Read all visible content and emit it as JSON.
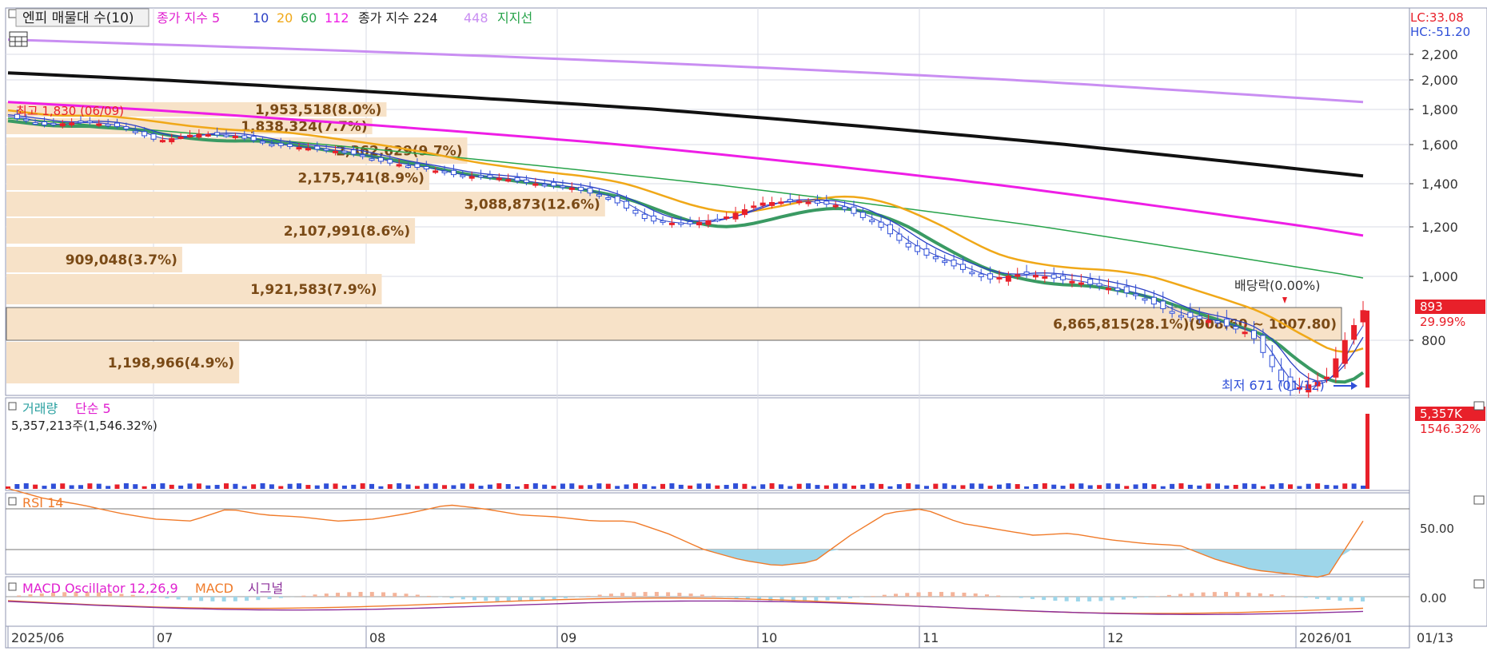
{
  "colors": {
    "up": "#e8202a",
    "down": "#2f4fd8",
    "ma5": "#2a3fc4",
    "ma10": "#2a3fc4",
    "ma20": "#f0a818",
    "ma60": "#27a34a",
    "ma112": "#ee1ee6",
    "ma224": "#111111",
    "ma448": "#c98ef2",
    "support": "#3a9a63",
    "volprofile": "#f7e2c8",
    "volprofile_text": "#7a4a16",
    "rsi": "#f07b2a",
    "rsi_fill": "#9ed6ea",
    "macd": "#f07b2a",
    "signal": "#8c2f9b",
    "osc": "#9ed6ea",
    "panel_bg": "#ffffff",
    "axis_bg": "#ffffff",
    "grid": "#d9dbe6"
  },
  "price_panel": {
    "legend": {
      "title_label": "엔피 매물대 수(10)",
      "ma_label": "종가 지수 5",
      "ma10": "10",
      "ma20": "20",
      "ma60": "60",
      "ma112": "112",
      "ma224_label": "종가 지수 224",
      "ma448": "448",
      "support_label": "지지선"
    },
    "lc_text": "LC:33.08",
    "hc_text": "HC:-51.20",
    "high_annotation": "최고 1,830 (06/09)",
    "low_annotation": "최저 671 (01/12)",
    "dividend_annotation": "배당락(0.00%)",
    "current_price_tag": "893",
    "current_change_tag": "29.99%",
    "y_ticks": [
      "2,200",
      "2,000",
      "1,800",
      "1,600",
      "1,400",
      "1,200",
      "1,000",
      "800"
    ]
  },
  "volume_profile": [
    {
      "label": "1,953,518(8.0%)",
      "price_level": 1690
    },
    {
      "label": "1,838,324(7.7%)",
      "price_level": 1605
    },
    {
      "label": "2,362,629(9.7%)",
      "price_level": 1510
    },
    {
      "label": "2,175,741(8.9%)",
      "price_level": 1410
    },
    {
      "label": "3,088,873(12.6%)",
      "price_level": 1300
    },
    {
      "label": "2,107,991(8.6%)",
      "price_level": 1195
    },
    {
      "label": "909,048(3.7%)",
      "price_level": 1095
    },
    {
      "label": "1,921,583(7.9%)",
      "price_level": 985
    },
    {
      "label": "6,865,815(28.1%)(908.60 ~ 1007.80)",
      "price_level": 880
    },
    {
      "label": "1,198,966(4.9%)",
      "price_level": 775
    }
  ],
  "volume_panel": {
    "legend_label": "거래량",
    "legend_ma": "단순 5",
    "last_text": "5,357,213주(1,546.32%)",
    "tag_value": "5,357K",
    "tag_change": "1546.32%"
  },
  "rsi_panel": {
    "legend_label": "RSI 14",
    "tick": "50.00",
    "level": 50
  },
  "macd_panel": {
    "legend_osc": "MACD Oscillator 12,26,9",
    "legend_macd": "MACD",
    "legend_signal": "시그널",
    "tick": "0.00"
  },
  "x_axis": {
    "labels": [
      "2025/06",
      "07",
      "08",
      "09",
      "10",
      "11",
      "12",
      "2026/01"
    ],
    "right_label": "01/13"
  },
  "chart_data": {
    "type": "candlestick",
    "x": [
      "2025/06",
      "07",
      "08",
      "09",
      "10",
      "11",
      "12",
      "2026/01"
    ],
    "close_path": [
      1760,
      1710,
      1730,
      1700,
      1620,
      1660,
      1650,
      1600,
      1580,
      1560,
      1510,
      1480,
      1440,
      1430,
      1400,
      1380,
      1330,
      1230,
      1210,
      1240,
      1310,
      1320,
      1300,
      1220,
      1110,
      1050,
      990,
      1010,
      990,
      970,
      940,
      880,
      860,
      820,
      671,
      700,
      893
    ],
    "ma224_path": [
      2055,
      1440
    ],
    "ma448_path": [
      2315,
      1850
    ],
    "ma112_path": [
      1850,
      1165
    ],
    "ma60_path": [
      1750,
      995
    ],
    "ma20_path": [
      1730,
      850
    ],
    "support_path": [
      1560,
      750
    ],
    "high": {
      "value": 1830,
      "date": "06/09"
    },
    "low": {
      "value": 671,
      "date": "01/12"
    },
    "last_close": 893,
    "last_volume": 5357213,
    "ylim": [
      650,
      2400
    ],
    "rsi_path": [
      60,
      55,
      52,
      48,
      45,
      44,
      50,
      47,
      46,
      44,
      45,
      48,
      52,
      50,
      47,
      46,
      44,
      44,
      38,
      30,
      25,
      22,
      24,
      37,
      48,
      50,
      43,
      40,
      37,
      38,
      35,
      33,
      32,
      25,
      20,
      18,
      16,
      44
    ]
  }
}
